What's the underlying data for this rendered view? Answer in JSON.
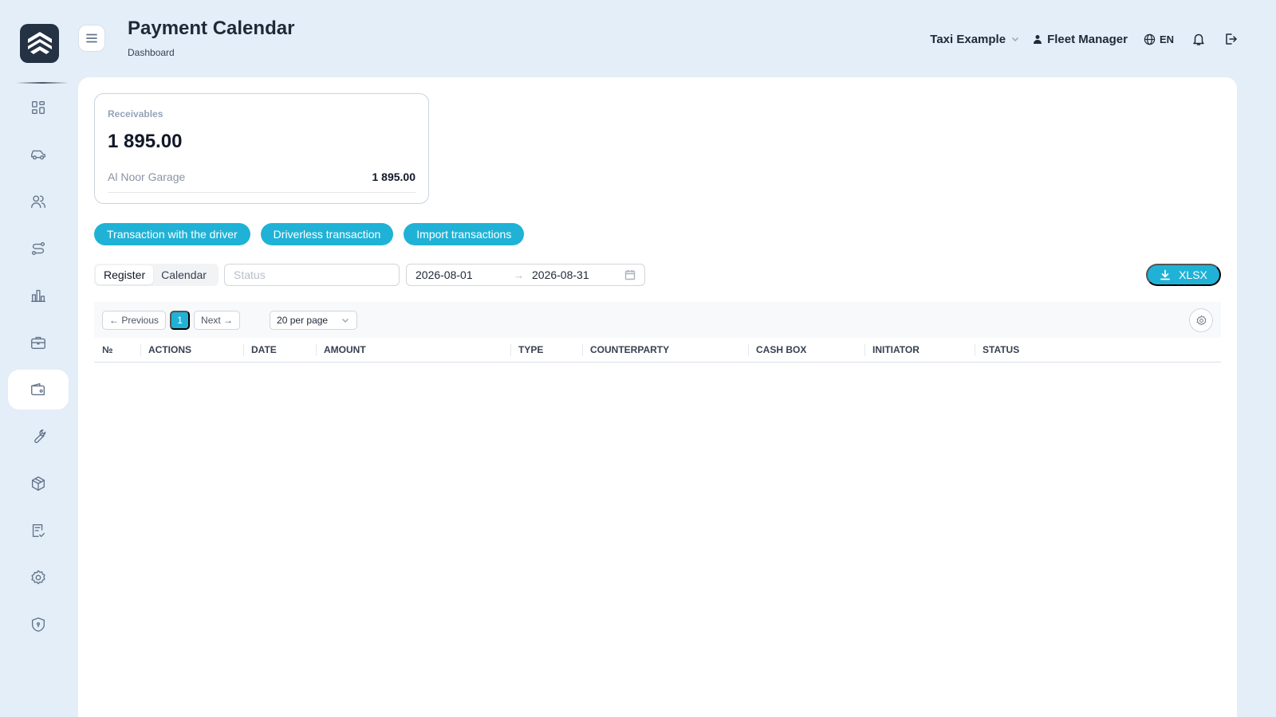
{
  "header": {
    "title": "Payment Calendar",
    "breadcrumb": "Dashboard",
    "company": "Taxi Example",
    "user": "Fleet Manager",
    "language": "EN"
  },
  "sidebar": {
    "items": [
      {
        "icon": "dashboard-icon"
      },
      {
        "icon": "car-icon"
      },
      {
        "icon": "users-icon"
      },
      {
        "icon": "route-icon"
      },
      {
        "icon": "bar-chart-icon"
      },
      {
        "icon": "briefcase-icon"
      },
      {
        "icon": "wallet-icon",
        "active": true
      },
      {
        "icon": "wrench-icon"
      },
      {
        "icon": "package-icon"
      },
      {
        "icon": "checklist-icon"
      },
      {
        "icon": "settings-icon"
      },
      {
        "icon": "shield-icon"
      }
    ]
  },
  "receivables": {
    "label": "Receivables",
    "total": "1 895.00",
    "rows": [
      {
        "name": "Al Noor Garage",
        "amount": "1 895.00"
      }
    ]
  },
  "actions": {
    "driver_transaction": "Transaction with the driver",
    "driverless_transaction": "Driverless transaction",
    "import_transactions": "Import transactions"
  },
  "filters": {
    "view_tabs": [
      "Register",
      "Calendar"
    ],
    "active_tab": "Register",
    "status_placeholder": "Status",
    "date_from": "2026-08-01",
    "date_to": "2026-08-31",
    "export_label": "XLSX"
  },
  "pagination": {
    "previous": "← Previous",
    "current_page": "1",
    "next": "Next →",
    "per_page": "20 per page"
  },
  "table": {
    "columns": [
      "№",
      "ACTIONS",
      "DATE",
      "AMOUNT",
      "TYPE",
      "COUNTERPARTY",
      "CASH BOX",
      "INITIATOR",
      "STATUS"
    ],
    "rows": []
  },
  "colors": {
    "accent": "#20b2d6",
    "background": "#e4eef8",
    "logo_bg": "#243244"
  }
}
